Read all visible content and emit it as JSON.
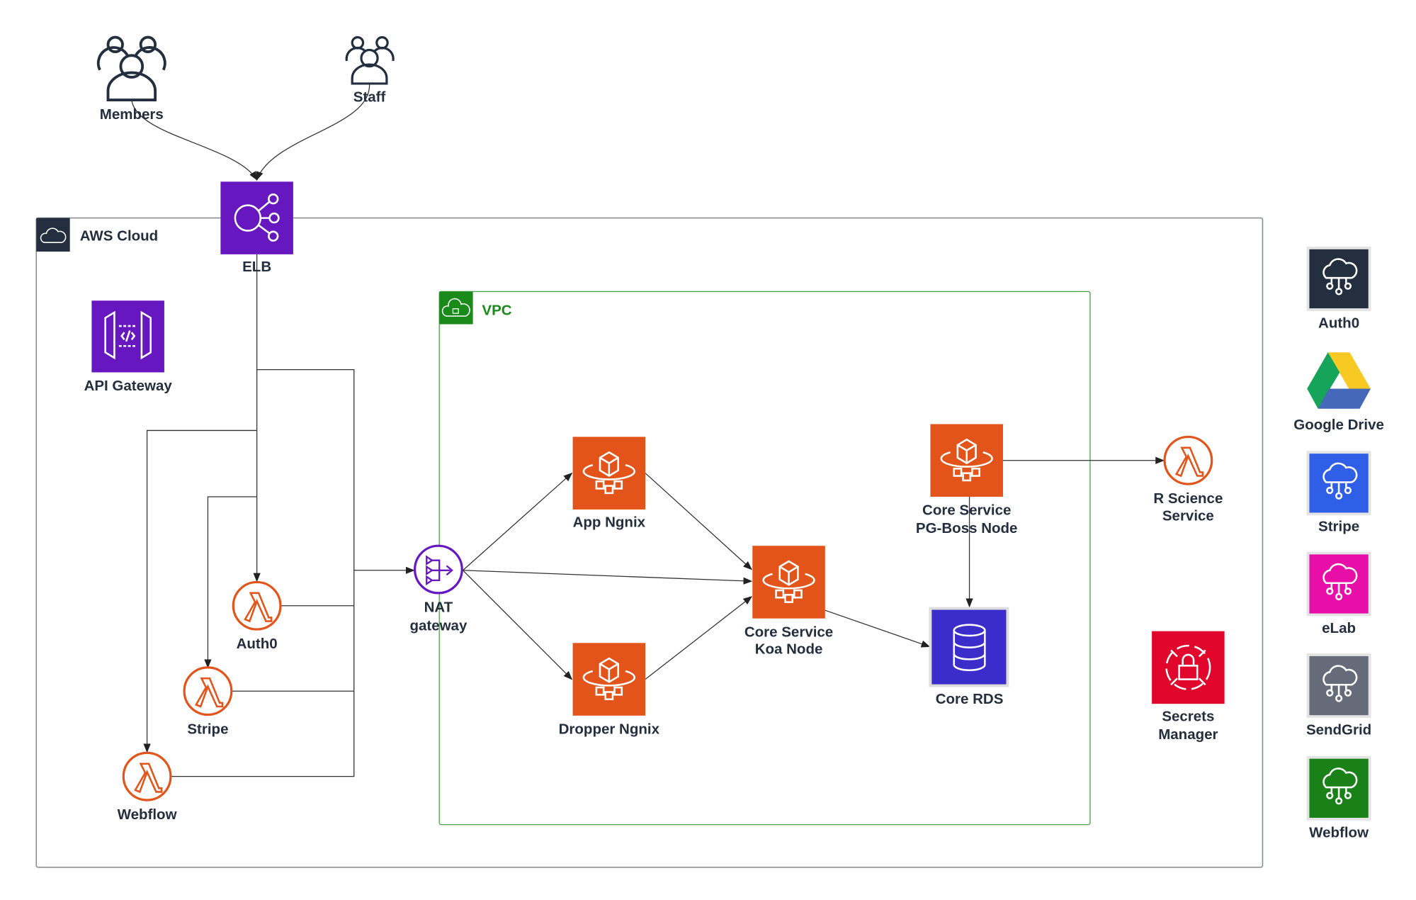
{
  "actors": {
    "members": "Members",
    "staff": "Staff"
  },
  "groups": {
    "aws_cloud": "AWS Cloud",
    "vpc": "VPC"
  },
  "nodes": {
    "elb": "ELB",
    "api_gateway": "API Gateway",
    "nat_line1": "NAT",
    "nat_line2": "gateway",
    "lambda_auth0": "Auth0",
    "lambda_stripe": "Stripe",
    "lambda_webflow": "Webflow",
    "app_ngnix": "App Ngnix",
    "dropper_ngnix": "Dropper Ngnix",
    "koa_line1": "Core Service",
    "koa_line2": "Koa Node",
    "pgboss_line1": "Core Service",
    "pgboss_line2": "PG-Boss Node",
    "core_rds": "Core RDS",
    "rscience_line1": "R Science",
    "rscience_line2": "Service",
    "secrets_line1": "Secrets",
    "secrets_line2": "Manager"
  },
  "external": [
    {
      "label": "Auth0",
      "color": "#232f3e"
    },
    {
      "label": "Google Drive"
    },
    {
      "label": "Stripe",
      "color": "#2f5fe6"
    },
    {
      "label": "eLab",
      "color": "#e80fa8"
    },
    {
      "label": "SendGrid",
      "color": "#656b78"
    },
    {
      "label": "Webflow",
      "color": "#1a8018"
    }
  ],
  "colors": {
    "purple": "#6617c0",
    "orange": "#e3541a",
    "rds": "#3b2ccc",
    "secrets": "#e0062c",
    "vpc_green": "#1a8a1a",
    "aws_dark": "#232f3e"
  }
}
